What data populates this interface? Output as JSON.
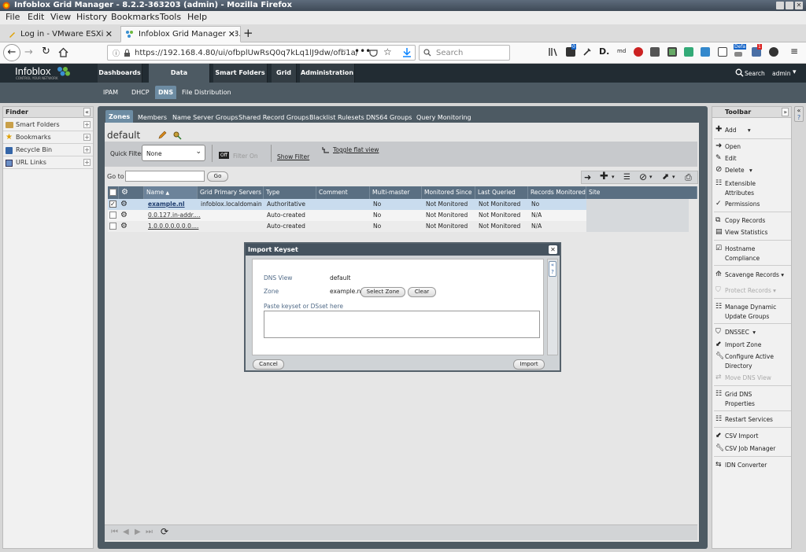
{
  "window": {
    "title": "Infoblox Grid Manager - 8.2.2-363203 (admin) - Mozilla Firefox"
  },
  "menu": [
    "File",
    "Edit",
    "View",
    "History",
    "Bookmarks",
    "Tools",
    "Help"
  ],
  "tabs": [
    {
      "label": "Log in - VMware ESXi",
      "active": false
    },
    {
      "label": "Infoblox Grid Manager - 8.2",
      "active": true
    }
  ],
  "nav": {
    "url": "https://192.168.4.80/ui/ofbplUwRsQ0q7kLq1lJ9dw/ofb1a/",
    "url_dim": "7",
    "search_placeholder": "Search",
    "ext_badge_a": "0",
    "ext_badge_b": "1",
    "ext_defa": "Defa",
    "ext_md": "md"
  },
  "header": {
    "logo": "Infoblox",
    "logo_sub": "CONTROL YOUR NETWORK",
    "nav": [
      "Dashboards",
      "Data Management",
      "Smart Folders",
      "Grid",
      "Administration"
    ],
    "active_nav": "Data Management",
    "search": "Search",
    "user": "admin"
  },
  "subnav": [
    "IPAM",
    "DHCP",
    "DNS",
    "File Distribution"
  ],
  "finder": {
    "title": "Finder",
    "items": [
      "Smart Folders",
      "Bookmarks",
      "Recycle Bin",
      "URL Links"
    ]
  },
  "zone_tabs": [
    "Zones",
    "Members",
    "Name Server Groups",
    "Shared Record Groups",
    "Blacklist Rulesets",
    "DNS64 Groups",
    "Query Monitoring"
  ],
  "view_title": "default",
  "filter": {
    "quick_filter_label": "Quick Filter",
    "quick_filter_value": "None",
    "toggle_off": "Off",
    "filter_on": "Filter On",
    "show_filter": "Show Filter",
    "toggle_flat": "Toggle flat view"
  },
  "goto": {
    "label": "Go to",
    "button": "Go"
  },
  "grid": {
    "columns": [
      "Name",
      "Grid Primary Servers",
      "Type",
      "Comment",
      "Multi-master Zone",
      "Monitored Since",
      "Last Queried",
      "Records Monitored",
      "Site"
    ],
    "sort_indicator": "▲",
    "rows": [
      {
        "name": "example.nl",
        "server": "infoblox.localdomain",
        "type": "Authoritative",
        "comment": "",
        "multi": "No",
        "since": "Not Monitored",
        "queried": "Not Monitored",
        "records": "No",
        "site": "",
        "checked": true
      },
      {
        "name": "0.0.127.in-addr....",
        "server": "",
        "type": "Auto-created",
        "comment": "",
        "multi": "No",
        "since": "Not Monitored",
        "queried": "Not Monitored",
        "records": "N/A",
        "site": "",
        "checked": false
      },
      {
        "name": "1.0.0.0.0.0.0.0....",
        "server": "",
        "type": "Auto-created",
        "comment": "",
        "multi": "No",
        "since": "Not Monitored",
        "queried": "Not Monitored",
        "records": "N/A",
        "site": "",
        "checked": false
      }
    ]
  },
  "toolbar": {
    "title": "Toolbar",
    "items": [
      "Add",
      "Open",
      "Edit",
      "Delete",
      "Extensible Attributes",
      "Permissions",
      "Copy Records",
      "View Statistics",
      "Hostname Compliance",
      "Scavenge Records",
      "Protect Records",
      "Manage Dynamic Update Groups",
      "DNSSEC",
      "Import Zone",
      "Configure Active Directory",
      "Move DNS View",
      "Grid DNS Properties",
      "Restart Services",
      "CSV Import",
      "CSV Job Manager",
      "IDN Converter"
    ]
  },
  "dialog": {
    "title": "Import Keyset",
    "dns_view_label": "DNS View",
    "dns_view_value": "default",
    "zone_label": "Zone",
    "zone_value": "example.nl",
    "select_zone": "Select Zone",
    "clear": "Clear",
    "paste_label": "Paste keyset or DSset here",
    "paste_value": "",
    "cancel": "Cancel",
    "import": "Import"
  },
  "colors": {
    "header": "#222c33",
    "subnav": "#4d5a63",
    "grid_header": "#5a6f82",
    "selected_row": "#c9dcee",
    "accent": "#6d8ca3"
  }
}
